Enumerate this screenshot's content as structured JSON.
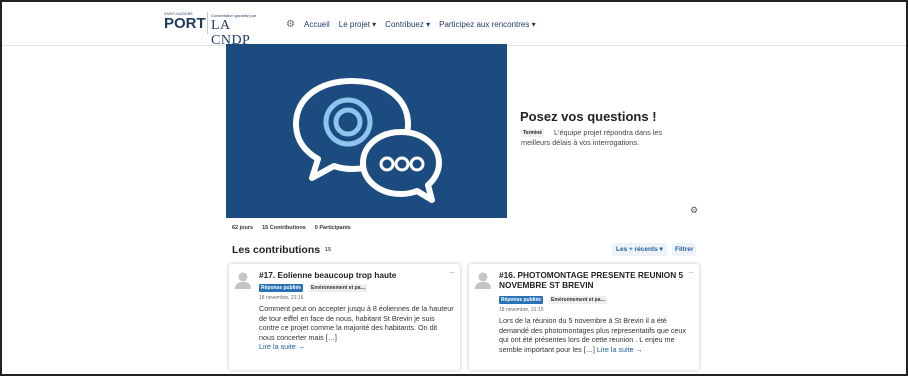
{
  "header": {
    "port_logo_small": "SAINT-NAZAIRE\nPORT",
    "port_logo_big": "PORT",
    "cndp_logo_small": "Concertation garantie par",
    "cndp_logo_big": "LA CNDP",
    "nav": [
      "Accueil",
      "Le projet ▾",
      "Contribuez ▾",
      "Participez aux rencontres ▾"
    ]
  },
  "hero": {
    "title": "Posez vos questions !",
    "status": "Terminé",
    "text_line1": "L'équipe projet répondra dans les",
    "text_line2": "meilleurs délais à vos interrogations.",
    "colors": {
      "background": "#1c4b80",
      "accent": "#8fc5ec"
    }
  },
  "stats": [
    "62 jours",
    "15 Contributions",
    "0 Participants"
  ],
  "contributions": {
    "title": "Les contributions",
    "count": "15",
    "sort_label": "Les + récents ▾",
    "filter_label": "Filtrer"
  },
  "cards": [
    {
      "title": "#17. Eolienne beaucoup trop haute",
      "status": "Réponse publiée",
      "category": "Environnement et pa…",
      "date": "18 novembre, 21:16",
      "body": "Comment peut on accepter jusqu à 8 éoliennes de la hauteur de tour eiffel en face de nous, habitant St Brevin je suis contre ce projet comme la majorité des habitants. On dit nous concerter mais […]",
      "link": "Lire la suite →"
    },
    {
      "title": "#16. PHOTOMONTAGE PRESENTE REUNION 5 NOVEMBRE ST BREVIN",
      "status": "Réponse publiée",
      "category": "Environnement et pa…",
      "date": "18 novembre, 21:15",
      "body": "Lors de la réunion du 5 novembre à St Brevin il a été demandé des photomontages plus representatifs que ceux qui ont été présentes lors de cette reunion . L enjeu me semble important pour les […]",
      "link": "Lire la suite →"
    }
  ]
}
